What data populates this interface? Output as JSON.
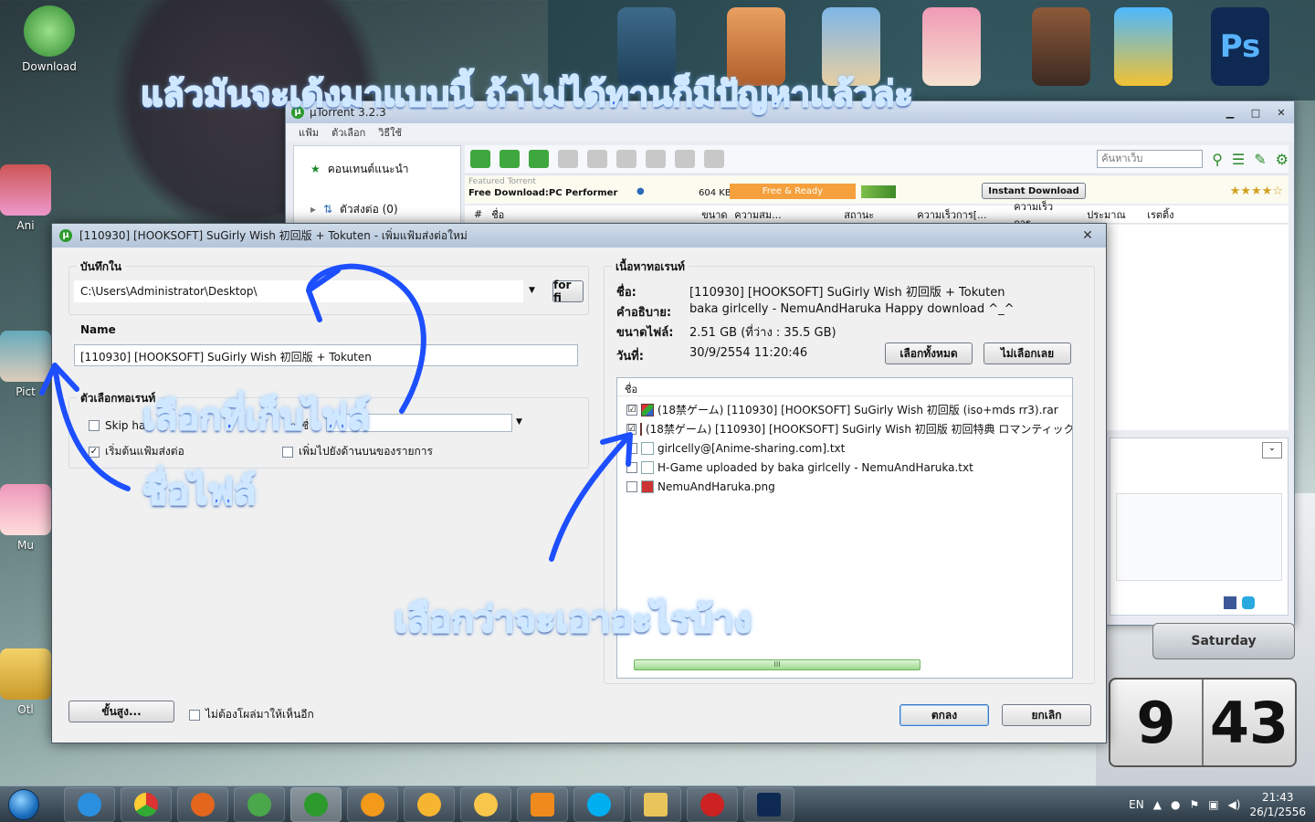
{
  "desktop": {
    "icons": [
      {
        "label": "Download"
      },
      {
        "label": "Ani"
      },
      {
        "label": "Pict"
      },
      {
        "label": "Mu"
      },
      {
        "label": "Otl"
      }
    ]
  },
  "annotations": {
    "top": "แล้วมันจะเด้งมาแบบนี้ ถ้าไม่ได้ทานก็มีปัญหาแล้วล่ะ",
    "choose_folder": "เลือกที่เก็บไฟล์",
    "file_name": "ชื่อไฟล์",
    "choose_items": "เลือกว่าจะเอาอะไรบ้าง"
  },
  "utorrent": {
    "title": "µTorrent 3.2.3",
    "menu": [
      "แฟ้ม",
      "ตัวเลือก",
      "วิธีใช้"
    ],
    "sidebar": [
      {
        "label": "คอนเทนต์แนะนำ"
      },
      {
        "label": "ตัวส่งต่อ (0)"
      }
    ],
    "search_placeholder": "ค้นหาเว็บ",
    "ad": {
      "featured": "Featured Torrent",
      "text": "Free Download:PC Performer",
      "size": "604 KB",
      "ready": "Free & Ready",
      "instant": "Instant Download",
      "stars": "★★★★☆"
    },
    "columns": [
      "#",
      "ชื่อ",
      "ขนาด",
      "ความสม...",
      "สถานะ",
      "ความเร็วการ[...",
      "ความเร็วการ...",
      "ประมาณ",
      "เรตติ้ง"
    ]
  },
  "dialog": {
    "title": "[110930] [HOOKSOFT] SuGirly Wish 初回版 + Tokuten - เพิ่มแฟ้มส่งต่อใหม่",
    "save_in_label": "บันทึกใน",
    "save_path": "C:\\Users\\Administrator\\Desktop\\",
    "browse_label": "for fi",
    "name_label": "Name",
    "name_value": "[110930] [HOOKSOFT] SuGirly Wish 初回版 + Tokuten",
    "torrent_options_label": "ตัวเลือกทอเรนท์",
    "skip_hash": "Skip ha",
    "start_torrent": "เริ่มต้นแฟ้มส่งต่อ",
    "add_to_top": "เพิ่มไปยังด้านบนของรายการ",
    "label_hint": "ป้ายชื่",
    "advanced_button": "ขั้นสูง...",
    "dont_show_again": "ไม่ต้องโผล่มาให้เห็นอีก",
    "content_label": "เนื้อหาทอเรนท์",
    "info": {
      "name_key": "ชื่อ:",
      "name_val": "[110930] [HOOKSOFT] SuGirly Wish 初回版 + Tokuten",
      "desc_key": "คำอธิบาย:",
      "desc_val": "baka girlcelly - NemuAndHaruka Happy download ^_^",
      "size_key": "ขนาดไฟล์:",
      "size_val": "2.51 GB (ที่ว่าง : 35.5 GB)",
      "date_key": "วันที่:",
      "date_val": "30/9/2554 11:20:46"
    },
    "select_all": "เลือกทั้งหมด",
    "select_none": "ไม่เลือกเลย",
    "tree_header": "ชื่อ",
    "files": [
      {
        "name": "(18禁ゲーム) [110930] [HOOKSOFT] SuGirly Wish 初回版 (iso+mds rr3).rar",
        "checked": "☑"
      },
      {
        "name": "(18禁ゲーム) [110930] [HOOKSOFT] SuGirly Wish 初回版 初回特典 ロマンティック",
        "checked": "☑"
      },
      {
        "name": "girlcelly@[Anime-sharing.com].txt",
        "checked": ""
      },
      {
        "name": "H-Game uploaded by baka girlcelly - NemuAndHaruka.txt",
        "checked": ""
      },
      {
        "name": "NemuAndHaruka.png",
        "checked": ""
      }
    ],
    "scroll_grip": "III",
    "ok": "ตกลง",
    "cancel": "ยกเลิก"
  },
  "gadget": {
    "day": "Saturday",
    "hour": "9",
    "minute": "43"
  },
  "taskbar": {
    "lang": "EN",
    "time": "21:43",
    "date": "26/1/2556"
  },
  "colors": {
    "annotation_blue": "#1d4fff",
    "utorrent_green": "#2c9a2c"
  }
}
